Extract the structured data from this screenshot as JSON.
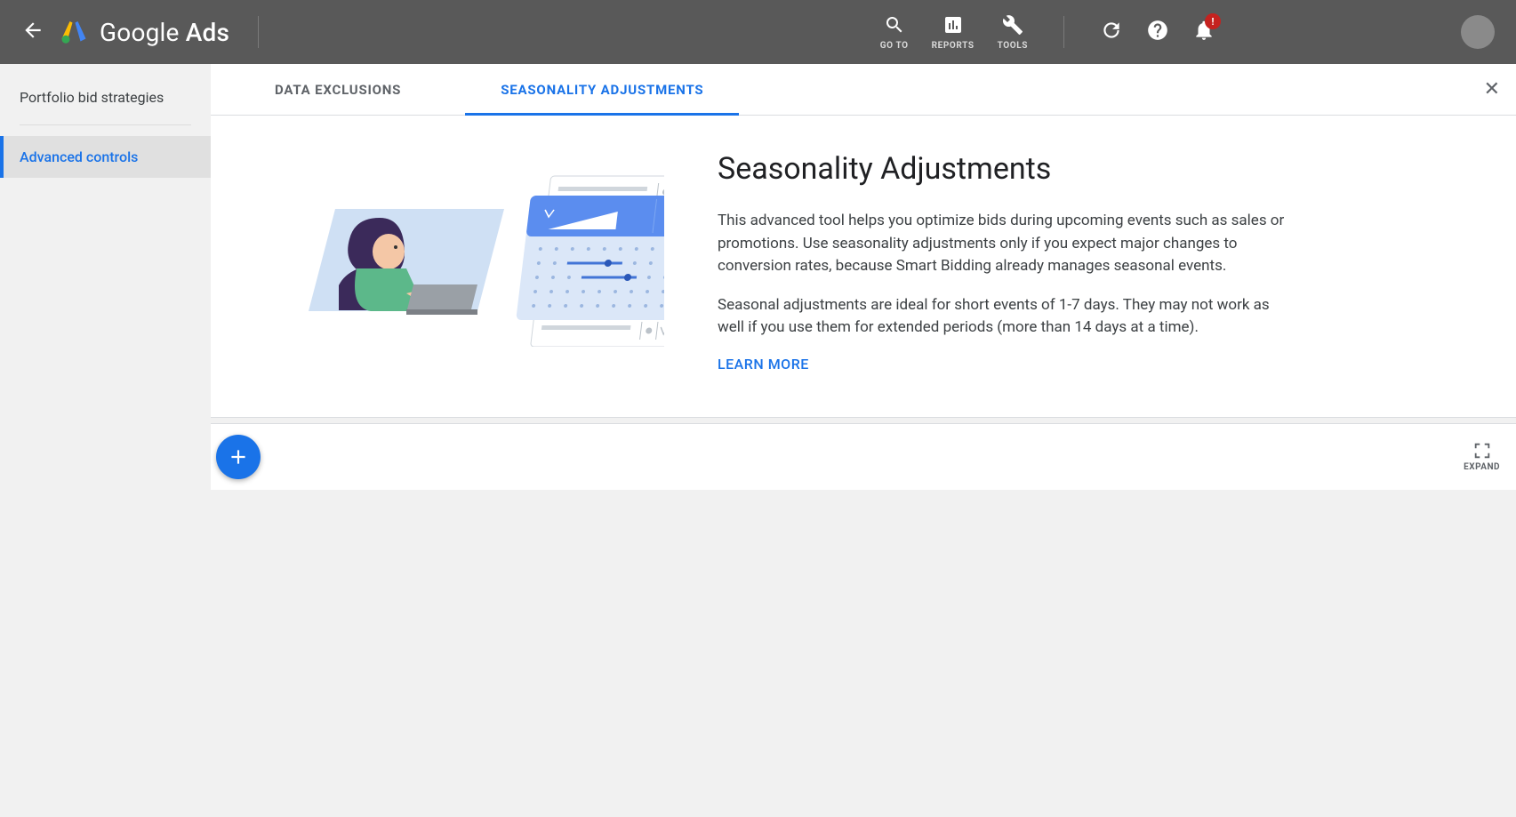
{
  "header": {
    "brand_normal": "Google",
    "brand_bold": " Ads",
    "nav": {
      "goto": "GO TO",
      "reports": "REPORTS",
      "tools": "TOOLS"
    },
    "notification_badge": "!"
  },
  "sidebar": {
    "items": [
      {
        "label": "Portfolio bid strategies"
      },
      {
        "label": "Advanced controls"
      }
    ]
  },
  "tabs": {
    "data_exclusions": "DATA EXCLUSIONS",
    "seasonality": "SEASONALITY ADJUSTMENTS"
  },
  "intro": {
    "title": "Seasonality Adjustments",
    "p1": "This advanced tool helps you optimize bids during upcoming events such as sales or promotions. Use seasonality adjustments only if you expect major changes to conversion rates, because Smart Bidding already manages seasonal events.",
    "p2": "Seasonal adjustments are ideal for short events of 1-7 days. They may not work as well if you use them for extended periods (more than 14 days at a time).",
    "learn_more": "LEARN MORE"
  },
  "actionbar": {
    "expand": "EXPAND"
  }
}
